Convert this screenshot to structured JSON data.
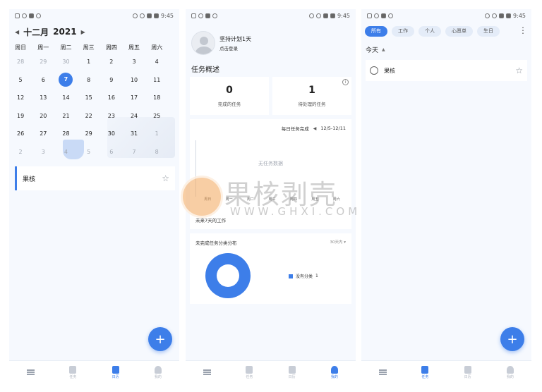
{
  "status_bar": {
    "time": "9:45"
  },
  "calendar_screen": {
    "month": "十二月",
    "year": "2021",
    "weekdays": [
      "周日",
      "周一",
      "周二",
      "周三",
      "周四",
      "周五",
      "周六"
    ],
    "weeks": [
      [
        "28",
        "29",
        "30",
        "1",
        "2",
        "3",
        "4"
      ],
      [
        "5",
        "6",
        "7",
        "8",
        "9",
        "10",
        "11"
      ],
      [
        "12",
        "13",
        "14",
        "15",
        "16",
        "17",
        "18"
      ],
      [
        "19",
        "20",
        "21",
        "22",
        "23",
        "24",
        "25"
      ],
      [
        "26",
        "27",
        "28",
        "29",
        "30",
        "31",
        "1"
      ],
      [
        "2",
        "3",
        "4",
        "5",
        "6",
        "7",
        "8"
      ]
    ],
    "today": "7",
    "task_title": "果核",
    "nav": [
      "",
      "任务",
      "日历",
      "我的"
    ],
    "fab": "+"
  },
  "profile_screen": {
    "name": "坚持计划1天",
    "subtitle": "点击登录",
    "overview_title": "任务概述",
    "completed_count": "0",
    "completed_label": "完成的任务",
    "pending_count": "1",
    "pending_label": "待处理的任务",
    "daily_title": "每日任务完成",
    "daily_range": "12/5-12/11",
    "daily_empty": "无任务数据",
    "daily_days": [
      "周日",
      "周一",
      "周二",
      "周三",
      "周四",
      "周五",
      "周六"
    ],
    "daily_footer": "未来7天的工作",
    "dist_title": "未完成任务分类分布",
    "dist_range": "30天内",
    "legend_label": "没有分类",
    "legend_value": "1",
    "nav": [
      "",
      "任务",
      "日历",
      "我的"
    ]
  },
  "tasks_screen": {
    "chips": [
      "所有",
      "工作",
      "个人",
      "心愿单",
      "生日"
    ],
    "group_title": "今天",
    "task_title": "果核",
    "nav": [
      "",
      "任务",
      "日历",
      "我的"
    ],
    "fab": "+"
  },
  "watermark": {
    "title": "果核剥壳",
    "url": "WWW.GHXI.COM"
  },
  "colors": {
    "accent": "#3d7ee9",
    "background": "#f6f9fe"
  }
}
